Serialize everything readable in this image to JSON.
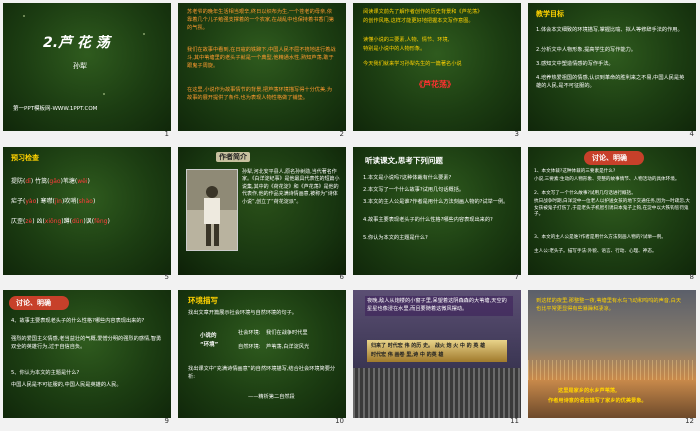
{
  "slides": {
    "s1": {
      "title": "2.芦 花 荡",
      "author": "孙犁",
      "footer": "第一PPT模板网-WWW.1PPT.COM",
      "num": "1"
    },
    "s2": {
      "p1": "苏老爷的晚年生活相当艰辛,终日以织布为生,一个苍老的母亲,依靠着几个儿子勉强支撑着的一个农家,在战乱中也保持着书香门第的气氛。",
      "p2": "我们在故事中看到,在日寇的铁蹄下,中国人民不屈不挠地进行着战斗,其中苇塘里的老头子就是一个典型,他精通水性,熟知芦荡,敢于跟鬼子周旋。",
      "p3": "在这里,小说作为故事情节的背景,把芦荡环境描写得十分优美,为故事的展开提供了条件,也为表现人物性格做了铺垫。",
      "num": "2"
    },
    "s3": {
      "p1": "阅读课文前先了解作者创作的历史背景和《芦花荡》",
      "p2": "的创作风格,这样才能更好地把握本文写作意图。",
      "p3": "读懂小说的三要素,人物、情节、环境,",
      "p4": "特别是小说中的人物形象。",
      "p5": "今天我们就来学习孙犁先生的一篇著名小说",
      "title": "《芦花荡》",
      "num": "3"
    },
    "s4": {
      "head": "教学目标",
      "items": [
        "1.体会本文细致的环境描写,掌握比喻、拟人等修辞手法的作用。",
        "2.分析文中人物形象,提高学生的写作能力。",
        "3.感知文中塑造情感的写作手法。",
        "4.培养热爱祖国的情感,认识到革命的胜利来之不易,中国人民是英雄的人民,是不可征服的。"
      ],
      "num": "4"
    },
    "s5": {
      "head": "预习检查",
      "rows": [
        [
          "提防(",
          "dī",
          ")",
          " 竹篙(",
          "gāo",
          ")",
          "苇塘(",
          "wěi",
          ")"
        ],
        [
          "疟子(",
          "yào",
          ")",
          " 寒噤(",
          "jìn",
          ")",
          "吹哨(",
          "shào",
          ")"
        ],
        [
          "仄歪(",
          "zè",
          ")",
          " 凶(",
          "xiōng",
          ")",
          "蹲(",
          "dūn",
          ")",
          "讽(",
          "fěng",
          ")"
        ]
      ],
      "num": "5"
    },
    "s6": {
      "head": "作者简介",
      "bio": "孙犁,河北安平县人,原名孙树勋,当代著名作家。《白洋淀纪事》是他最具代表性的短篇小说集,其中的《荷花淀》和《芦花荡》是他的代表作,他的作品充满诗情画意,被称为“诗体小说”,创立了“荷花淀派”。",
      "num": "6"
    },
    "s7": {
      "head": "听读课文,思考下列问题",
      "items": [
        "1.本文是小说吗?这种体裁有什么要素?",
        "2.本文写了一个什么故事?试用几句话概括。",
        "3.本文的主人公是谁?作者是用什么方法刻画人物的?试举一例。",
        "4.故事主要表现老头子的什么性格?哪些内容表现出来的?",
        "5.你认为本文的主题是什么?"
      ],
      "num": "7"
    },
    "s8": {
      "head": "讨论、明确",
      "items": [
        "1、本文体裁?这种体裁的三要素是什么?",
        "   小说,三要素:生动的人物形象、完整的故事情节、人物活动的具体环境。",
        "2、本文写了一个什么故事?试用几句话进行概括。",
        "   抗日战争时期,白洋淀中一位老人以护送女孩的地下交通任务,因为一时疏忽,大女孩被鬼子打伤了,于是老头子机智引诱日本鬼子上钩,在淀中以大铁钩惩罚鬼子。",
        "3、本文的主人公是谁?作者是用什么方法刻画人物的?试举一例。",
        "   主人公:老头子。描写手法:外貌、语言、行动、心理、神态。"
      ],
      "num": "8"
    },
    "s9": {
      "head": "讨论、明确",
      "items": [
        "4、故事主要表现老头子的什么性格?哪些内容表现出来的?",
        "   强烈的爱国主义情感,老当益壮的气概,爱憎分明的强烈的感情,智勇双全的英雄行为,过于自信自负。",
        "5、你认为本文的主题是什么?",
        "   中国人民是不可征服的,中国人民是英雄的人民。"
      ],
      "num": "9"
    },
    "s10": {
      "head": "环境描写",
      "intro": "找出文章开篇展示社会环境与自然环境的句子。",
      "label1": "小说的",
      "label2": "“环境”",
      "env1": "社会环境:",
      "env1v": "我们在战争时代里",
      "env2": "自然环境:",
      "env2v": "芦苇荡,白洋淀风光",
      "outro": "找出课文中“充满诗情画意”的自然环境描写,结合社会环境简要分析:",
      "source": "——精析第二自然段",
      "num": "10"
    },
    "s11": {
      "top": "夜晚,敌人从炮楼的小窗子里,呆望着这阴森森的大苇塘,天空的星星也像浸在水里,而且要随着这微风摆动。",
      "mid": "归来了 时代宏 伟 的历 史。 战火 炮 火 中 的 英 雄",
      "mid2": "时代宏 伟 画卷 里,诗 中 的英 雄",
      "num": "11"
    },
    "s12": {
      "top": "到这样的夜里,那整整一夜,苇塘里有水鸟飞动和呜呜的声音,白天也比平常更显得有些暴躁和凄凉。",
      "bottom1": "这里是家乡的水乡芦苇荡,",
      "bottom2": "作者用诗意的语言描写了家乡的优美景象。",
      "num": "12"
    }
  }
}
